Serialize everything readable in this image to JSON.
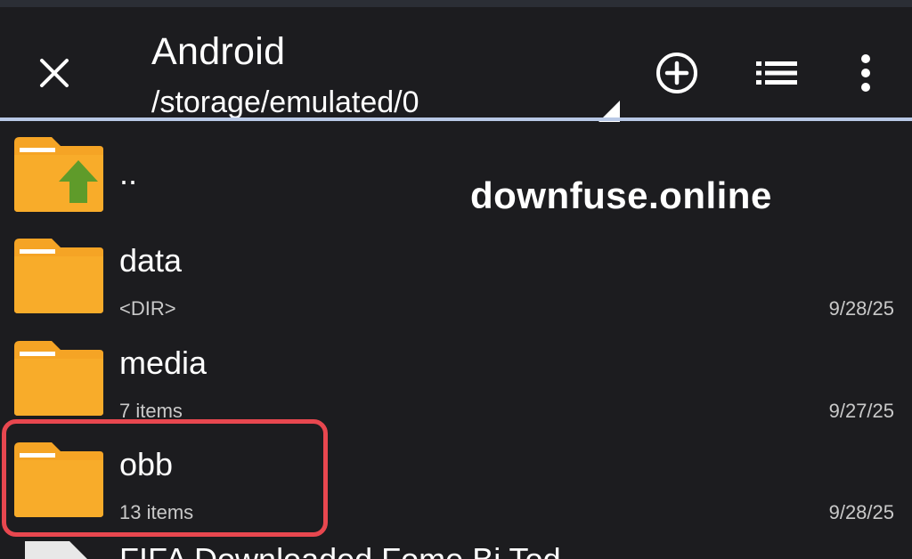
{
  "header": {
    "title": "Android",
    "path": "/storage/emulated/0"
  },
  "watermark": "downfuse.online",
  "colors": {
    "background": "#1c1c1f",
    "folder": "#f5a425",
    "folder_tab": "#f7b234",
    "up_arrow": "#5f9b2a",
    "divider": "#b8c8e6",
    "highlight": "#e8474f"
  },
  "icons": {
    "close": "close-icon",
    "add": "add-circle-icon",
    "list": "list-view-icon",
    "more": "more-vert-icon",
    "folder": "folder-icon",
    "folder_up": "folder-up-icon",
    "file": "file-icon"
  },
  "files": [
    {
      "name": "..",
      "info": "",
      "date": ""
    },
    {
      "name": "data",
      "info": "<DIR>",
      "date": "9/28/25"
    },
    {
      "name": "media",
      "info": "7 items",
      "date": "9/27/25"
    },
    {
      "name": "obb",
      "info": "13 items",
      "date": "9/28/25"
    }
  ],
  "partial_row": {
    "name": "FIFA Downloaded Fome Bi Tod..."
  }
}
